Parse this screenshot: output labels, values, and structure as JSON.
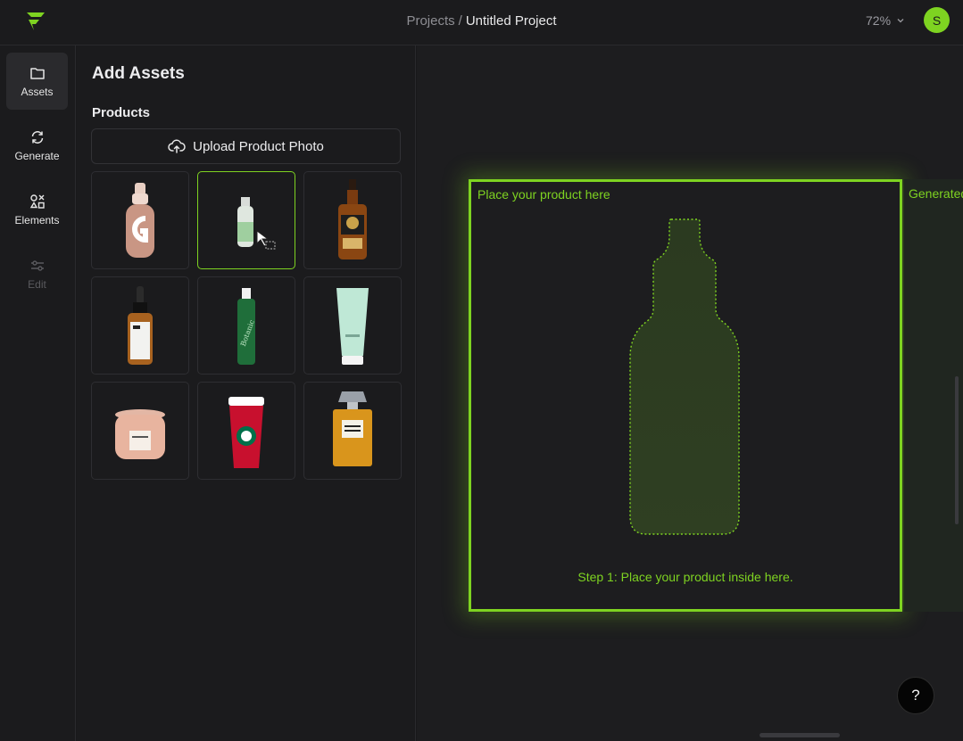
{
  "header": {
    "breadcrumb_parent": "Projects",
    "breadcrumb_separator": "/",
    "project_title": "Untitled Project",
    "zoom": "72%",
    "avatar_initial": "S",
    "accent_color": "#7ed321"
  },
  "rail": {
    "items": [
      {
        "label": "Assets",
        "icon": "folder-icon",
        "active": true
      },
      {
        "label": "Generate",
        "icon": "refresh-icon"
      },
      {
        "label": "Elements",
        "icon": "shapes-icon"
      },
      {
        "label": "Edit",
        "icon": "sliders-icon",
        "disabled": true
      }
    ]
  },
  "panel": {
    "title": "Add Assets",
    "section": "Products",
    "upload_label": "Upload Product Photo",
    "products": [
      {
        "name": "foundation-bottle"
      },
      {
        "name": "spray-bottle",
        "selected": true
      },
      {
        "name": "whiskey-bottle"
      },
      {
        "name": "serum-dropper"
      },
      {
        "name": "green-bottle"
      },
      {
        "name": "mint-tube"
      },
      {
        "name": "candle-jar"
      },
      {
        "name": "coffee-cup"
      },
      {
        "name": "perfume-bottle"
      }
    ]
  },
  "canvas": {
    "frame_label": "Place your product here",
    "step_text": "Step 1: Place your product inside here.",
    "generated_label": "Generated",
    "help_label": "?"
  }
}
